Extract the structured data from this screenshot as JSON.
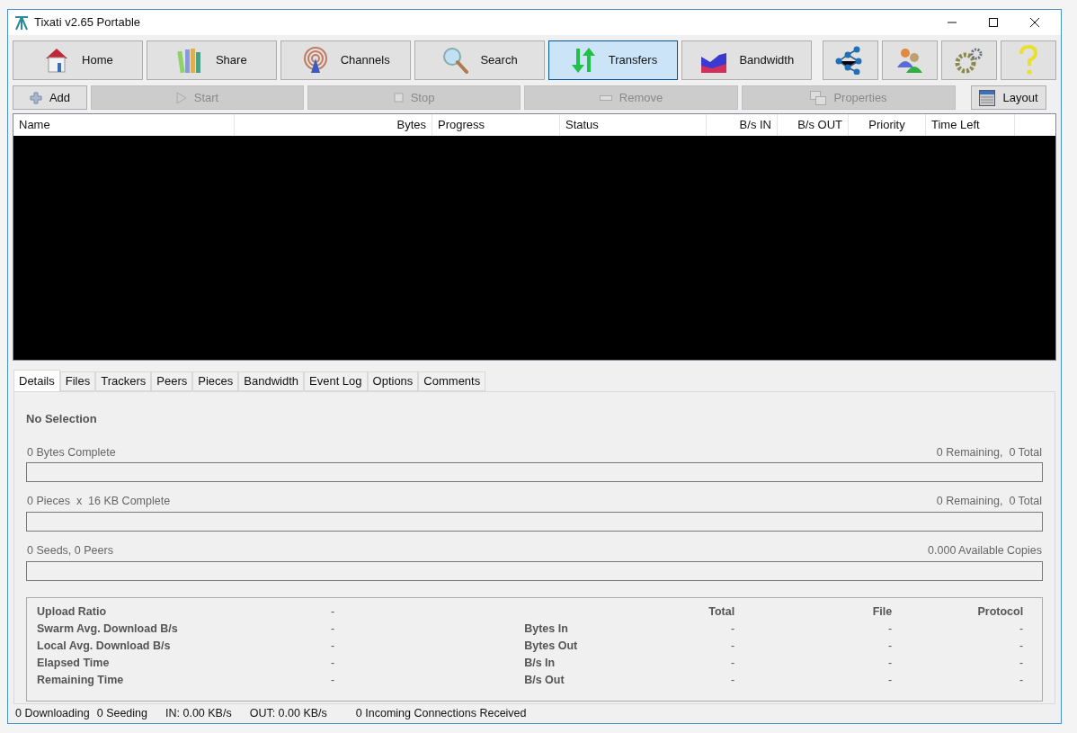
{
  "window": {
    "title": "Tixati v2.65 Portable"
  },
  "nav_buttons": [
    {
      "label": "Home",
      "selected": false
    },
    {
      "label": "Share",
      "selected": false
    },
    {
      "label": "Channels",
      "selected": false
    },
    {
      "label": "Search",
      "selected": false
    },
    {
      "label": "Transfers",
      "selected": true
    },
    {
      "label": "Bandwidth",
      "selected": false
    }
  ],
  "toolbar": [
    {
      "label": "Add",
      "disabled": false
    },
    {
      "label": "Start",
      "disabled": true
    },
    {
      "label": "Stop",
      "disabled": true
    },
    {
      "label": "Remove",
      "disabled": true
    },
    {
      "label": "Properties",
      "disabled": true
    },
    {
      "label": "Layout",
      "disabled": false
    }
  ],
  "table": {
    "columns": [
      "Name",
      "Bytes",
      "Progress",
      "Status",
      "B/s IN",
      "B/s OUT",
      "Priority",
      "Time Left"
    ]
  },
  "tabs": [
    {
      "label": "Details",
      "selected": true
    },
    {
      "label": "Files",
      "selected": false
    },
    {
      "label": "Trackers",
      "selected": false
    },
    {
      "label": "Peers",
      "selected": false
    },
    {
      "label": "Pieces",
      "selected": false
    },
    {
      "label": "Bandwidth",
      "selected": false
    },
    {
      "label": "Event Log",
      "selected": false
    },
    {
      "label": "Options",
      "selected": false
    },
    {
      "label": "Comments",
      "selected": false
    }
  ],
  "details": {
    "title": "No Selection",
    "bars": [
      {
        "left": "0 Bytes Complete",
        "right": "0 Remaining,  0 Total",
        "level": 0
      },
      {
        "left": "0 Pieces  x  16 KB Complete",
        "right": "0 Remaining,  0 Total",
        "level": 0
      },
      {
        "left": "0 Seeds, 0 Peers",
        "right": "0.000 Available Copies",
        "level": 0
      }
    ],
    "stats": [
      {
        "label": "Upload Ratio",
        "value": "-"
      },
      {
        "label": "Swarm Avg. Download B/s",
        "value": "-"
      },
      {
        "label": "Local Avg. Download B/s",
        "value": "-"
      },
      {
        "label": "Elapsed Time",
        "value": "-"
      },
      {
        "label": "Remaining Time",
        "value": "-"
      }
    ],
    "traffic": {
      "columns": [
        "Total",
        "File",
        "Protocol"
      ],
      "rows": [
        {
          "label": "Bytes In",
          "values": [
            "-",
            "-",
            "-"
          ]
        },
        {
          "label": "Bytes Out",
          "values": [
            "-",
            "-",
            "-"
          ]
        },
        {
          "label": "B/s In",
          "values": [
            "-",
            "-",
            "-"
          ]
        },
        {
          "label": "B/s Out",
          "values": [
            "-",
            "-",
            "-"
          ]
        }
      ]
    }
  },
  "status_bar": [
    "0 Downloading",
    "0 Seeding",
    "IN: 0.00 KB/s",
    "OUT: 0.00 KB/s",
    "0 Incoming Connections Received"
  ]
}
